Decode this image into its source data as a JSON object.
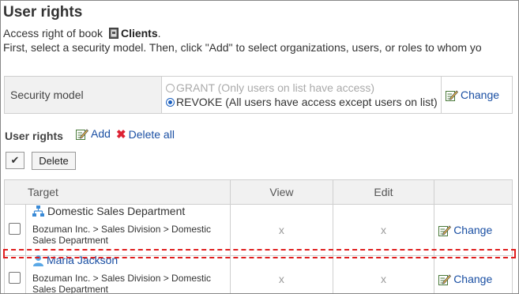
{
  "page": {
    "title": "User rights",
    "access_prefix": "Access right of book",
    "book_name": "Clients",
    "access_suffix": ".",
    "instruction": "First, select a security model. Then, click \"Add\" to select organizations, users, or roles to whom yo"
  },
  "security": {
    "label": "Security model",
    "grant": "GRANT (Only users on list have access)",
    "revoke": "REVOKE (All users have access except users on list)",
    "selected": "REVOKE",
    "change": "Change"
  },
  "rights": {
    "heading": "User rights",
    "add": "Add",
    "delete_all": "Delete all",
    "check_all": "✔",
    "delete": "Delete",
    "columns": {
      "target": "Target",
      "view": "View",
      "edit": "Edit"
    },
    "rows": [
      {
        "type": "organization",
        "name": "Domestic Sales Department",
        "path": "Bozuman Inc. > Sales Division > Domestic Sales Department",
        "view": "x",
        "edit": "x",
        "change": "Change"
      },
      {
        "type": "user",
        "name": "Maria Jackson",
        "path": "Bozuman Inc. > Sales Division > Domestic Sales Department",
        "view": "x",
        "edit": "x",
        "change": "Change"
      }
    ]
  },
  "colors": {
    "link": "#1a4fa3",
    "highlight": "#e01e1e",
    "header_bg": "#f1f1f1"
  }
}
